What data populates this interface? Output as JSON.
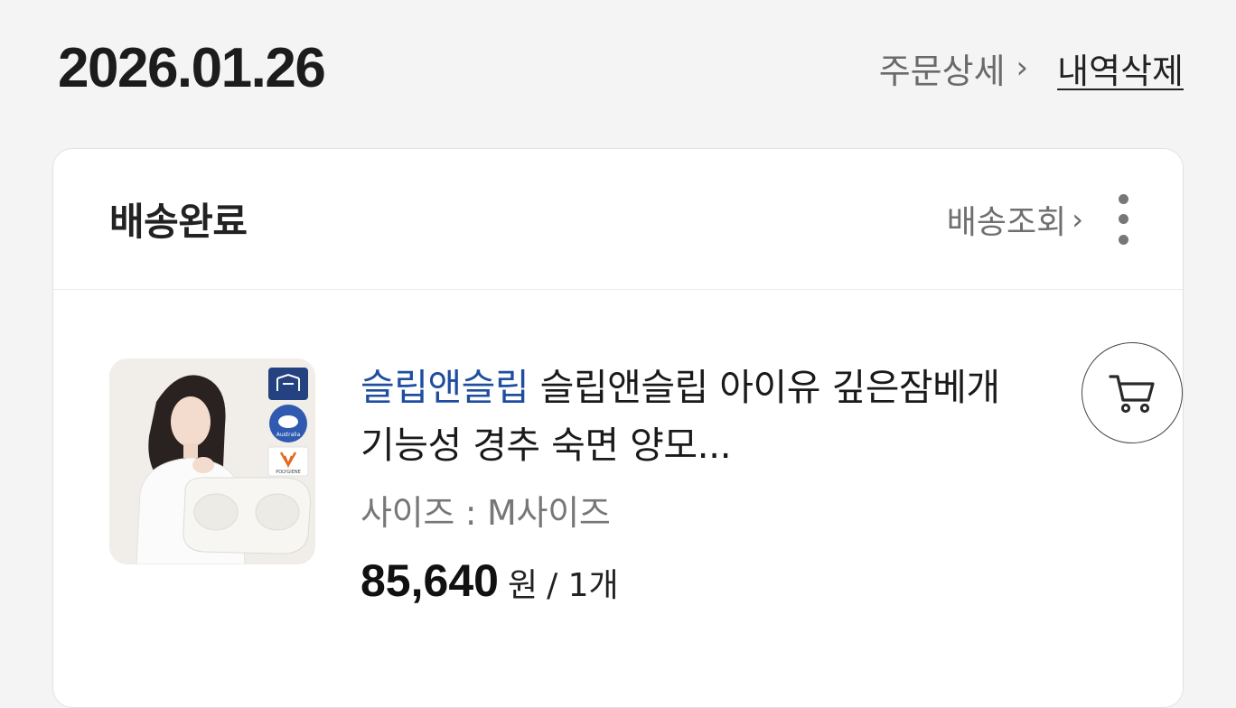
{
  "order": {
    "date": "2026.01.26",
    "detail_link": "주문상세",
    "delete_link": "내역삭제"
  },
  "shipment": {
    "status": "배송완료",
    "tracking_link": "배송조회"
  },
  "product": {
    "brand": "슬립앤슬립",
    "title": "슬립앤슬립 아이유 깊은잠베개 기능성 경추 숙면 양모...",
    "option": "사이즈 : M사이즈",
    "price": "85,640",
    "price_unit": "원",
    "quantity": "/ 1개",
    "thumbnail_badges": [
      "Australia",
      "POLYGIENE"
    ]
  },
  "icons": {
    "chevron": "chevron-right-icon",
    "more": "more-vertical-icon",
    "cart": "cart-icon"
  },
  "colors": {
    "brand_text": "#1f4ea0",
    "background": "#f4f4f4",
    "card": "#ffffff"
  }
}
